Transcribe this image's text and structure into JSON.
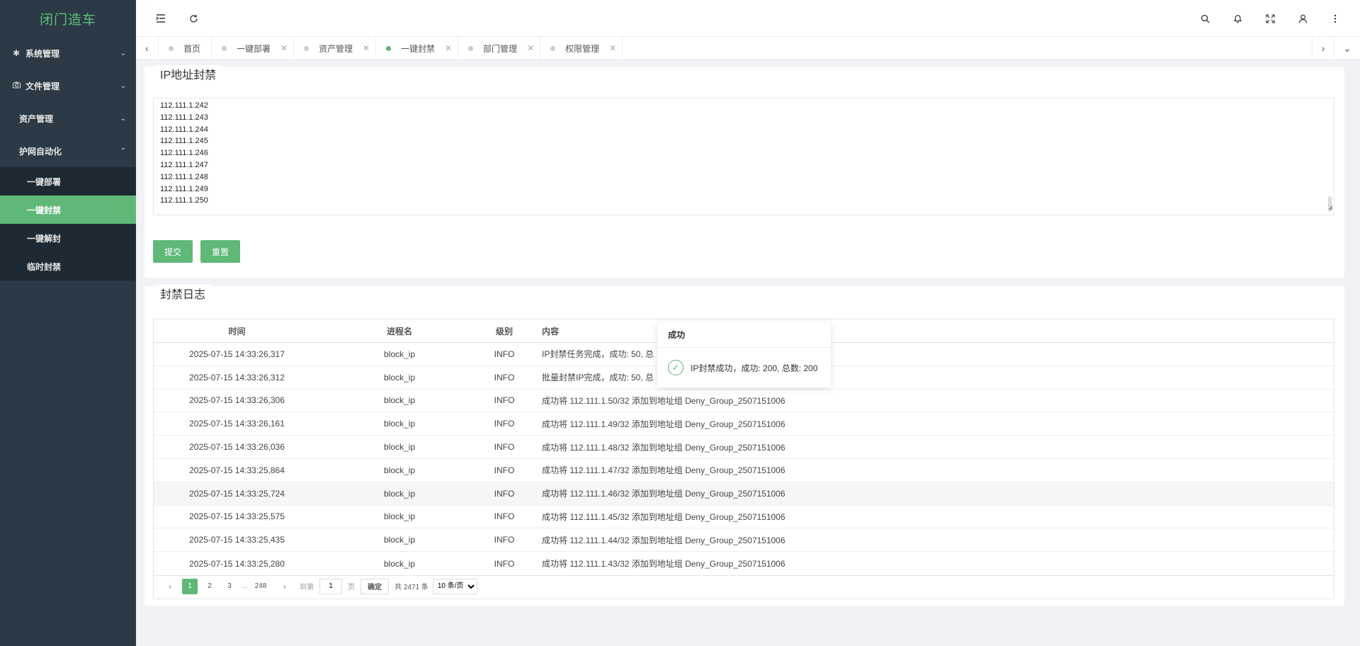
{
  "app": {
    "logo": "闭门造车"
  },
  "colors": {
    "accent": "#5fb878",
    "sidebar_bg": "#2b3a45",
    "submenu_bg": "#1e2a33"
  },
  "sidebar": {
    "groups": [
      {
        "label": "系统管理",
        "icon": "gear-icon",
        "chevron": "⌄"
      },
      {
        "label": "文件管理",
        "icon": "camera-icon",
        "chevron": "⌄"
      },
      {
        "label": "资产管理",
        "chevron": "⌄"
      },
      {
        "label": "护网自动化",
        "chevron": "⌃"
      }
    ],
    "subitems": [
      {
        "label": "一键部署"
      },
      {
        "label": "一键封禁"
      },
      {
        "label": "一键解封"
      },
      {
        "label": "临时封禁"
      }
    ]
  },
  "tabs": [
    {
      "label": "首页"
    },
    {
      "label": "一键部署"
    },
    {
      "label": "资产管理"
    },
    {
      "label": "一键封禁"
    },
    {
      "label": "部门管理"
    },
    {
      "label": "权限管理"
    }
  ],
  "ipform": {
    "title": "IP地址封禁",
    "textarea_value": "112.111.1.242\n112.111.1.243\n112.111.1.244\n112.111.1.245\n112.111.1.246\n112.111.1.247\n112.111.1.248\n112.111.1.249\n112.111.1.250",
    "submit_label": "提交",
    "reset_label": "重置"
  },
  "log": {
    "title": "封禁日志",
    "columns": [
      "时间",
      "进程名",
      "级别",
      "内容"
    ],
    "rows": [
      {
        "time": "2025-07-15 14:33:26,317",
        "proc": "block_ip",
        "level": "INFO",
        "content": "IP封禁任务完成，成功: 50, 总"
      },
      {
        "time": "2025-07-15 14:33:26,312",
        "proc": "block_ip",
        "level": "INFO",
        "content": "批量封禁IP完成，成功: 50, 总"
      },
      {
        "time": "2025-07-15 14:33:26,306",
        "proc": "block_ip",
        "level": "INFO",
        "content": "成功将 112.111.1.50/32 添加到地址组 Deny_Group_2507151006"
      },
      {
        "time": "2025-07-15 14:33:26,161",
        "proc": "block_ip",
        "level": "INFO",
        "content": "成功将 112.111.1.49/32 添加到地址组 Deny_Group_2507151006"
      },
      {
        "time": "2025-07-15 14:33:26,036",
        "proc": "block_ip",
        "level": "INFO",
        "content": "成功将 112.111.1.48/32 添加到地址组 Deny_Group_2507151006"
      },
      {
        "time": "2025-07-15 14:33:25,864",
        "proc": "block_ip",
        "level": "INFO",
        "content": "成功将 112.111.1.47/32 添加到地址组 Deny_Group_2507151006"
      },
      {
        "time": "2025-07-15 14:33:25,724",
        "proc": "block_ip",
        "level": "INFO",
        "content": "成功将 112.111.1.46/32 添加到地址组 Deny_Group_2507151006"
      },
      {
        "time": "2025-07-15 14:33:25,575",
        "proc": "block_ip",
        "level": "INFO",
        "content": "成功将 112.111.1.45/32 添加到地址组 Deny_Group_2507151006"
      },
      {
        "time": "2025-07-15 14:33:25,435",
        "proc": "block_ip",
        "level": "INFO",
        "content": "成功将 112.111.1.44/32 添加到地址组 Deny_Group_2507151006"
      },
      {
        "time": "2025-07-15 14:33:25,280",
        "proc": "block_ip",
        "level": "INFO",
        "content": "成功将 112.111.1.43/32 添加到地址组 Deny_Group_2507151006"
      }
    ]
  },
  "pagination": {
    "pages": [
      "1",
      "2",
      "3",
      "...",
      "248"
    ],
    "goto_label": "到第",
    "goto_value": "1",
    "page_unit": "页",
    "confirm_label": "确定",
    "total_label": "共 2471 条",
    "page_size": "10 条/页"
  },
  "toast": {
    "title": "成功",
    "message": "IP封禁成功，成功: 200, 总数: 200"
  }
}
